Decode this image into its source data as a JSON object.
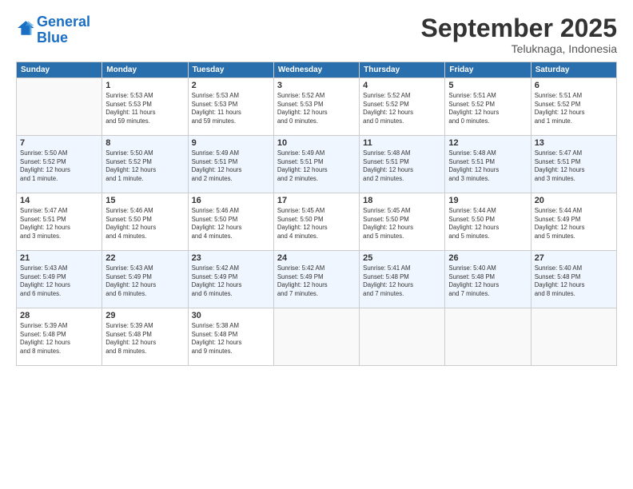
{
  "header": {
    "logo_line1": "General",
    "logo_line2": "Blue",
    "month": "September 2025",
    "location": "Teluknaga, Indonesia"
  },
  "weekdays": [
    "Sunday",
    "Monday",
    "Tuesday",
    "Wednesday",
    "Thursday",
    "Friday",
    "Saturday"
  ],
  "weeks": [
    [
      {
        "day": "",
        "info": ""
      },
      {
        "day": "1",
        "info": "Sunrise: 5:53 AM\nSunset: 5:53 PM\nDaylight: 11 hours\nand 59 minutes."
      },
      {
        "day": "2",
        "info": "Sunrise: 5:53 AM\nSunset: 5:53 PM\nDaylight: 11 hours\nand 59 minutes."
      },
      {
        "day": "3",
        "info": "Sunrise: 5:52 AM\nSunset: 5:53 PM\nDaylight: 12 hours\nand 0 minutes."
      },
      {
        "day": "4",
        "info": "Sunrise: 5:52 AM\nSunset: 5:52 PM\nDaylight: 12 hours\nand 0 minutes."
      },
      {
        "day": "5",
        "info": "Sunrise: 5:51 AM\nSunset: 5:52 PM\nDaylight: 12 hours\nand 0 minutes."
      },
      {
        "day": "6",
        "info": "Sunrise: 5:51 AM\nSunset: 5:52 PM\nDaylight: 12 hours\nand 1 minute."
      }
    ],
    [
      {
        "day": "7",
        "info": "Sunrise: 5:50 AM\nSunset: 5:52 PM\nDaylight: 12 hours\nand 1 minute."
      },
      {
        "day": "8",
        "info": "Sunrise: 5:50 AM\nSunset: 5:52 PM\nDaylight: 12 hours\nand 1 minute."
      },
      {
        "day": "9",
        "info": "Sunrise: 5:49 AM\nSunset: 5:51 PM\nDaylight: 12 hours\nand 2 minutes."
      },
      {
        "day": "10",
        "info": "Sunrise: 5:49 AM\nSunset: 5:51 PM\nDaylight: 12 hours\nand 2 minutes."
      },
      {
        "day": "11",
        "info": "Sunrise: 5:48 AM\nSunset: 5:51 PM\nDaylight: 12 hours\nand 2 minutes."
      },
      {
        "day": "12",
        "info": "Sunrise: 5:48 AM\nSunset: 5:51 PM\nDaylight: 12 hours\nand 3 minutes."
      },
      {
        "day": "13",
        "info": "Sunrise: 5:47 AM\nSunset: 5:51 PM\nDaylight: 12 hours\nand 3 minutes."
      }
    ],
    [
      {
        "day": "14",
        "info": "Sunrise: 5:47 AM\nSunset: 5:51 PM\nDaylight: 12 hours\nand 3 minutes."
      },
      {
        "day": "15",
        "info": "Sunrise: 5:46 AM\nSunset: 5:50 PM\nDaylight: 12 hours\nand 4 minutes."
      },
      {
        "day": "16",
        "info": "Sunrise: 5:46 AM\nSunset: 5:50 PM\nDaylight: 12 hours\nand 4 minutes."
      },
      {
        "day": "17",
        "info": "Sunrise: 5:45 AM\nSunset: 5:50 PM\nDaylight: 12 hours\nand 4 minutes."
      },
      {
        "day": "18",
        "info": "Sunrise: 5:45 AM\nSunset: 5:50 PM\nDaylight: 12 hours\nand 5 minutes."
      },
      {
        "day": "19",
        "info": "Sunrise: 5:44 AM\nSunset: 5:50 PM\nDaylight: 12 hours\nand 5 minutes."
      },
      {
        "day": "20",
        "info": "Sunrise: 5:44 AM\nSunset: 5:49 PM\nDaylight: 12 hours\nand 5 minutes."
      }
    ],
    [
      {
        "day": "21",
        "info": "Sunrise: 5:43 AM\nSunset: 5:49 PM\nDaylight: 12 hours\nand 6 minutes."
      },
      {
        "day": "22",
        "info": "Sunrise: 5:43 AM\nSunset: 5:49 PM\nDaylight: 12 hours\nand 6 minutes."
      },
      {
        "day": "23",
        "info": "Sunrise: 5:42 AM\nSunset: 5:49 PM\nDaylight: 12 hours\nand 6 minutes."
      },
      {
        "day": "24",
        "info": "Sunrise: 5:42 AM\nSunset: 5:49 PM\nDaylight: 12 hours\nand 7 minutes."
      },
      {
        "day": "25",
        "info": "Sunrise: 5:41 AM\nSunset: 5:48 PM\nDaylight: 12 hours\nand 7 minutes."
      },
      {
        "day": "26",
        "info": "Sunrise: 5:40 AM\nSunset: 5:48 PM\nDaylight: 12 hours\nand 7 minutes."
      },
      {
        "day": "27",
        "info": "Sunrise: 5:40 AM\nSunset: 5:48 PM\nDaylight: 12 hours\nand 8 minutes."
      }
    ],
    [
      {
        "day": "28",
        "info": "Sunrise: 5:39 AM\nSunset: 5:48 PM\nDaylight: 12 hours\nand 8 minutes."
      },
      {
        "day": "29",
        "info": "Sunrise: 5:39 AM\nSunset: 5:48 PM\nDaylight: 12 hours\nand 8 minutes."
      },
      {
        "day": "30",
        "info": "Sunrise: 5:38 AM\nSunset: 5:48 PM\nDaylight: 12 hours\nand 9 minutes."
      },
      {
        "day": "",
        "info": ""
      },
      {
        "day": "",
        "info": ""
      },
      {
        "day": "",
        "info": ""
      },
      {
        "day": "",
        "info": ""
      }
    ]
  ]
}
